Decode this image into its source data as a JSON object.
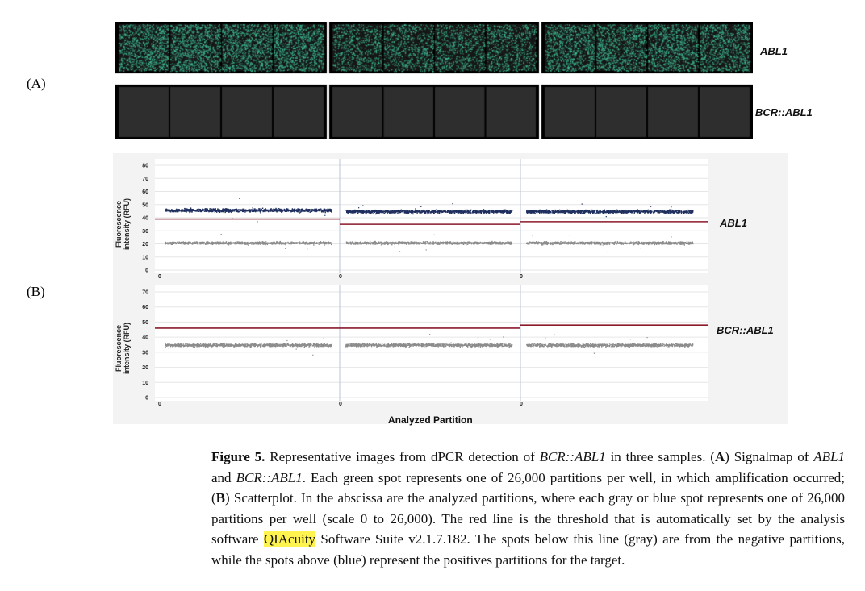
{
  "panel_a_label": "(A)",
  "panel_b_label": "(B)",
  "signalmap": {
    "row_labels": [
      "ABL1",
      "BCR::ABL1"
    ],
    "colors": {
      "positive_spot": "#3fbf98",
      "plate_bg": "#161616",
      "dim_plate": "#2e2e2e"
    }
  },
  "scatter": {
    "ylabel": "Fluorescence intensity (RFU)",
    "xlabel": "Analyzed Partition",
    "x_tick": "0",
    "colors": {
      "positive": "#1f2f5e",
      "negative": "#8c8c8c",
      "threshold": "#8b1a2b"
    }
  },
  "chart_data": [
    {
      "type": "scatter",
      "title": "ABL1",
      "xlabel": "Analyzed Partition",
      "ylabel": "Fluorescence intensity (RFU)",
      "ylim": [
        0,
        80
      ],
      "yticks": [
        "0",
        "10",
        "20",
        "30",
        "40",
        "50",
        "60",
        "70",
        "80"
      ],
      "grid": true,
      "samples": [
        {
          "positive_mean": 46,
          "negative_mean": 21,
          "threshold": 39
        },
        {
          "positive_mean": 45,
          "negative_mean": 21,
          "threshold": 35
        },
        {
          "positive_mean": 45,
          "negative_mean": 21,
          "threshold": 37
        }
      ]
    },
    {
      "type": "scatter",
      "title": "BCR::ABL1",
      "xlabel": "Analyzed Partition",
      "ylabel": "Fluorescence intensity (RFU)",
      "ylim": [
        0,
        70
      ],
      "yticks": [
        "0",
        "10",
        "20",
        "30",
        "40",
        "50",
        "60",
        "70"
      ],
      "grid": true,
      "samples": [
        {
          "positive_mean": null,
          "negative_mean": 35,
          "threshold": 46
        },
        {
          "positive_mean": null,
          "negative_mean": 35,
          "threshold": 46
        },
        {
          "positive_mean": null,
          "negative_mean": 35,
          "threshold": 48
        }
      ]
    }
  ],
  "caption": {
    "label": "Figure 5.",
    "t1": " Representative images from dPCR detection of ",
    "i1": "BCR::ABL1",
    "t2": " in three samples. (",
    "b1": "A",
    "t3": ") Signalmap of ",
    "i2": "ABL1",
    "t4": " and ",
    "i3": "BCR::ABL1",
    "t5": ". Each green spot represents one of 26,000 partitions per well, in which amplification occurred; (",
    "b2": "B",
    "t6": ") Scatterplot. In the abscissa are the analyzed partitions, where each gray or blue spot represents one of 26,000 partitions per well (scale 0 to 26,000). The red line is the threshold that is automatically set by the analysis software ",
    "hl": "QIAcuity",
    "t7": " Software Suite v2.1.7.182. The spots below this line (gray) are from the negative partitions, while the spots above (blue) represent the positives partitions for the target."
  }
}
